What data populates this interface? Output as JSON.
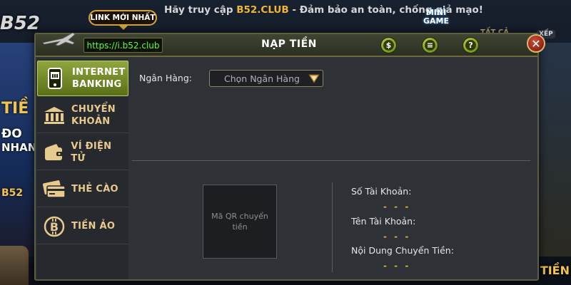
{
  "background": {
    "banner_prefix": "Hãy truy cập ",
    "banner_highlight": "B52.CLUB",
    "banner_suffix": " - Đảm bảo an toàn, chống giả mạo!",
    "link_badge": "LINK MỚI NHẤT",
    "logo": "B52",
    "mini_game": "MINI GAME",
    "tab_all": "TẤT CẢ",
    "sort": "XẾP",
    "left_texts": [
      "TIỀ",
      "ĐO",
      "NHAN",
      "B52"
    ],
    "right_texts": [
      "TIỀN"
    ]
  },
  "dialog": {
    "url": "https://i.b52.club",
    "title": "NẠP TIỀN",
    "header_icons": [
      "cash-icon",
      "document-icon",
      "help-icon"
    ],
    "header_icon_glyphs": [
      "$",
      "≡",
      "?"
    ],
    "close_glyph": "✕"
  },
  "sidebar": {
    "items": [
      {
        "label_line1": "INTERNET",
        "label_line2": "BANKING",
        "icon": "phone-bank-icon",
        "active": true
      },
      {
        "label_line1": "CHUYỂN",
        "label_line2": "KHOẢN",
        "icon": "bank-building-icon",
        "active": false
      },
      {
        "label_line1": "VÍ ĐIỆN TỬ",
        "label_line2": "",
        "icon": "wallet-icon",
        "active": false
      },
      {
        "label_line1": "THẺ CÀO",
        "label_line2": "",
        "icon": "card-icon",
        "active": false
      },
      {
        "label_line1": "TIỀN ẢO",
        "label_line2": "",
        "icon": "bitcoin-icon",
        "active": false
      }
    ]
  },
  "form": {
    "bank_label": "Ngân Hàng:",
    "bank_placeholder": "Chọn Ngân Hàng",
    "qr_text": "Mã QR chuyển tiền",
    "account_number_label": "Số Tài Khoản:",
    "account_number_value": "- - -",
    "account_name_label": "Tên Tài Khoản:",
    "account_name_value": "- - -",
    "transfer_content_label": "Nội Dung Chuyển Tiền:",
    "transfer_content_value": "- - -"
  },
  "colors": {
    "accent_green": "#7a9a14",
    "url_green": "#5cff3a",
    "gold": "#e6b13a",
    "close_red": "#8a1f12"
  }
}
